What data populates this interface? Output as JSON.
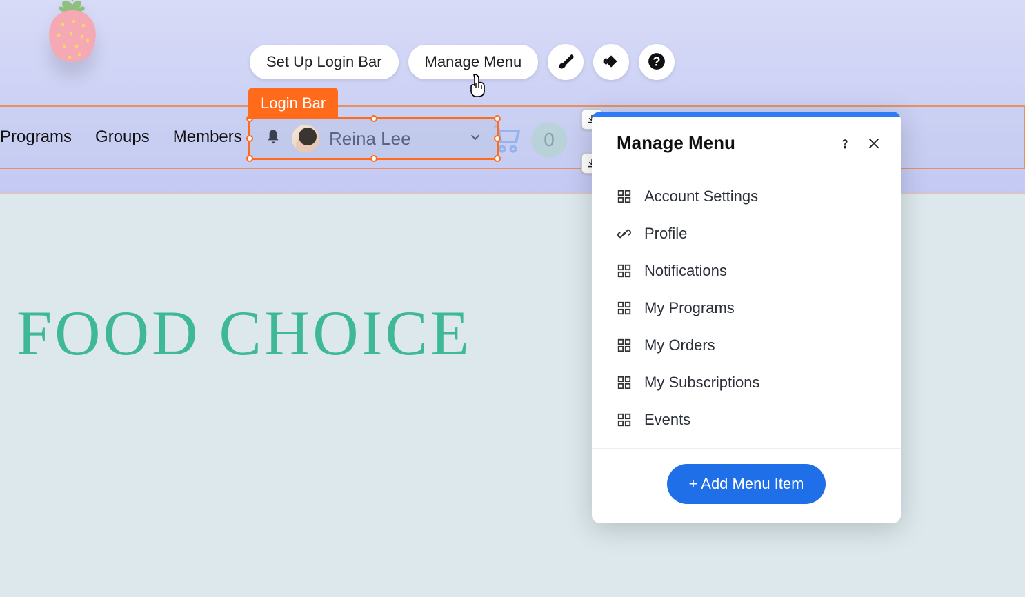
{
  "toolbar": {
    "setup_label": "Set Up Login Bar",
    "manage_label": "Manage Menu"
  },
  "selection": {
    "label": "Login Bar"
  },
  "nav": {
    "items": [
      "Programs",
      "Groups",
      "Members"
    ]
  },
  "login_bar": {
    "user_name": "Reina Lee"
  },
  "cart": {
    "count": "0"
  },
  "page": {
    "title": "FOOD CHOICE"
  },
  "panel": {
    "title": "Manage Menu",
    "items": [
      {
        "icon": "grid",
        "label": "Account Settings"
      },
      {
        "icon": "link",
        "label": "Profile"
      },
      {
        "icon": "grid",
        "label": "Notifications"
      },
      {
        "icon": "grid",
        "label": "My Programs"
      },
      {
        "icon": "grid",
        "label": "My Orders"
      },
      {
        "icon": "grid",
        "label": "My Subscriptions"
      },
      {
        "icon": "grid",
        "label": "Events"
      }
    ],
    "add_label": "+ Add Menu Item"
  }
}
